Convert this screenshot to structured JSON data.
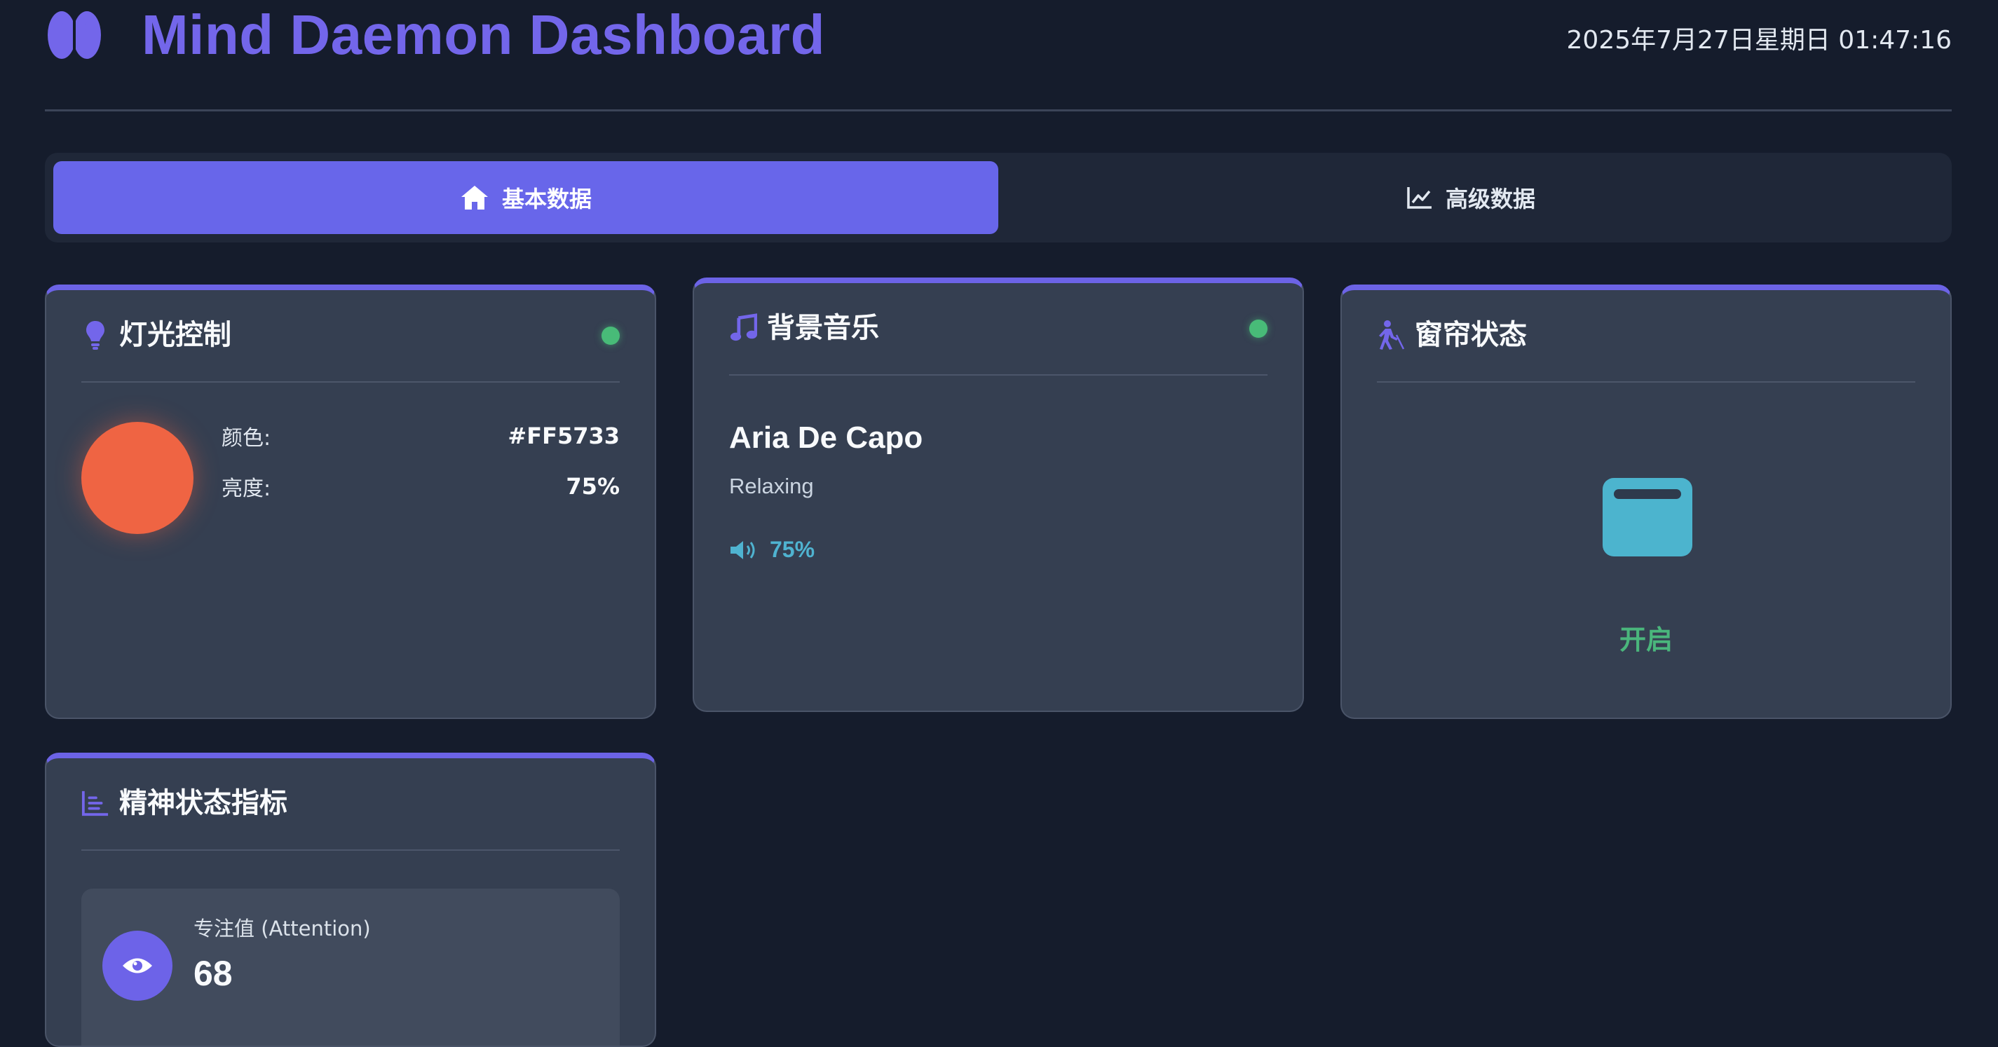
{
  "header": {
    "title": "Mind Daemon Dashboard",
    "datetime": "2025年7月27日星期日 01:47:16",
    "logo_icon": "brain-icon",
    "accent_color": "#7366ea"
  },
  "tabs": [
    {
      "label": "基本数据",
      "icon": "home-icon",
      "active": true
    },
    {
      "label": "高级数据",
      "icon": "line-chart-icon",
      "active": false
    }
  ],
  "light": {
    "title": "灯光控制",
    "icon": "lightbulb-icon",
    "status": "online",
    "color_label": "颜色:",
    "color_value": "#FF5733",
    "brightness_label": "亮度:",
    "brightness_value": "75%"
  },
  "music": {
    "title": "背景音乐",
    "icon": "music-note-icon",
    "status": "online",
    "song": "Aria De Capo",
    "genre": "Relaxing",
    "volume": "75%"
  },
  "curtain": {
    "title": "窗帘状态",
    "icon": "walking-person-icon",
    "status_text": "开启",
    "status_color": "#4ab67c"
  },
  "mental": {
    "title": "精神状态指标",
    "icon": "bar-chart-icon",
    "metrics": [
      {
        "label": "专注值 (Attention)",
        "value": "68",
        "icon": "eye-icon"
      }
    ]
  }
}
